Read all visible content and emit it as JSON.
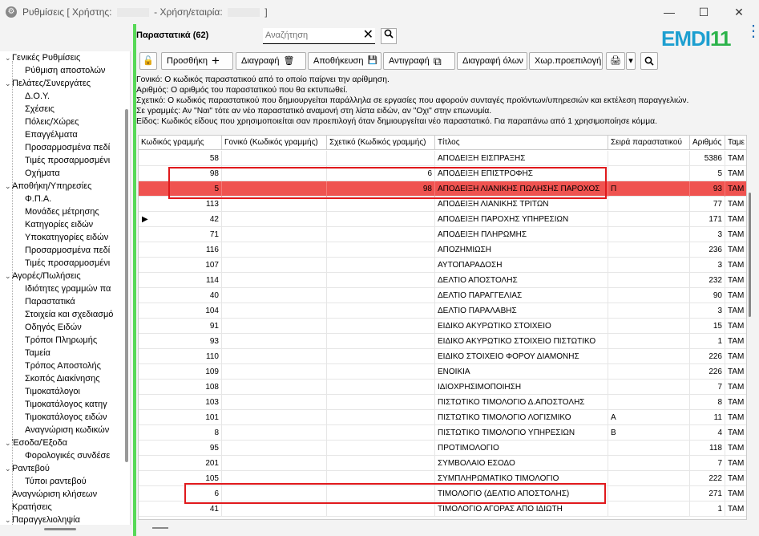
{
  "window": {
    "title": "Ρυθμίσεις",
    "user_label": "[ Χρήστης: ",
    "company_label": " - Χρήση/εταιρία: ",
    "close_bracket": " ]",
    "minimize": "—",
    "maximize": "☐",
    "close": "✕"
  },
  "sidebar": {
    "items": [
      {
        "label": "Γενικές Ρυθμίσεις",
        "level": 0,
        "expander": "⌄"
      },
      {
        "label": "Ρύθμιση αποστολών",
        "level": 1,
        "expander": ""
      },
      {
        "label": "Πελάτες/Συνεργάτες",
        "level": 0,
        "expander": "⌄"
      },
      {
        "label": "Δ.Ο.Υ.",
        "level": 1,
        "expander": ""
      },
      {
        "label": "Σχέσεις",
        "level": 1,
        "expander": ""
      },
      {
        "label": "Πόλεις/Χώρες",
        "level": 1,
        "expander": ""
      },
      {
        "label": "Επαγγέλματα",
        "level": 1,
        "expander": ""
      },
      {
        "label": "Προσαρμοσμένα πεδί",
        "level": 1,
        "expander": ""
      },
      {
        "label": "Τιμές προσαρμοσμένι",
        "level": 1,
        "expander": ""
      },
      {
        "label": "Οχήματα",
        "level": 1,
        "expander": ""
      },
      {
        "label": "Αποθήκη/Υπηρεσίες",
        "level": 0,
        "expander": "⌄"
      },
      {
        "label": "Φ.Π.Α.",
        "level": 1,
        "expander": ""
      },
      {
        "label": "Μονάδες μέτρησης",
        "level": 1,
        "expander": ""
      },
      {
        "label": "Κατηγορίες ειδών",
        "level": 1,
        "expander": ""
      },
      {
        "label": "Υποκατηγορίες ειδών",
        "level": 1,
        "expander": ""
      },
      {
        "label": "Προσαρμοσμένα πεδί",
        "level": 1,
        "expander": ""
      },
      {
        "label": "Τιμές προσαρμοσμένι",
        "level": 1,
        "expander": ""
      },
      {
        "label": "Αγορές/Πωλήσεις",
        "level": 0,
        "expander": "⌄"
      },
      {
        "label": "Ιδιότητες γραμμών πα",
        "level": 1,
        "expander": ""
      },
      {
        "label": "Παραστατικά",
        "level": 1,
        "expander": ""
      },
      {
        "label": "Στοιχεία και σχεδιασμό",
        "level": 1,
        "expander": ""
      },
      {
        "label": "Οδηγός Ειδών",
        "level": 1,
        "expander": ""
      },
      {
        "label": "Τρόποι Πληρωμής",
        "level": 1,
        "expander": ""
      },
      {
        "label": "Ταμεία",
        "level": 1,
        "expander": ""
      },
      {
        "label": "Τρόπος Αποστολής",
        "level": 1,
        "expander": ""
      },
      {
        "label": "Σκοπός Διακίνησης",
        "level": 1,
        "expander": ""
      },
      {
        "label": "Τιμοκατάλογοι",
        "level": 1,
        "expander": ""
      },
      {
        "label": "Τιμοκατάλογος κατηγ",
        "level": 1,
        "expander": ""
      },
      {
        "label": "Τιμοκατάλογος ειδών",
        "level": 1,
        "expander": ""
      },
      {
        "label": "Αναγνώριση κωδικών",
        "level": 1,
        "expander": ""
      },
      {
        "label": "Έσοδα/Έξοδα",
        "level": 0,
        "expander": "⌄"
      },
      {
        "label": "Φορολογικές συνδέσε",
        "level": 1,
        "expander": ""
      },
      {
        "label": "Ραντεβού",
        "level": 0,
        "expander": "⌄"
      },
      {
        "label": "Τύποι ραντεβού",
        "level": 1,
        "expander": ""
      },
      {
        "label": "Αναγνώριση κλήσεων",
        "level": 0,
        "expander": ""
      },
      {
        "label": "Κρατήσεις",
        "level": 0,
        "expander": ""
      },
      {
        "label": "Παραγγελιοληψία",
        "level": 0,
        "expander": "⌄"
      }
    ]
  },
  "header": {
    "title": "Παραστατικά (62)",
    "search_placeholder": "Αναζήτηση",
    "clear": "✕",
    "search_icon": "search-icon",
    "logo_main": "EMDI",
    "logo_accent": "11",
    "menu": "⋮"
  },
  "toolbar": {
    "lock": "🔓",
    "add": "Προσθήκη",
    "add_icon": "+",
    "delete": "Διαγραφή",
    "delete_icon": "🗑",
    "save": "Αποθήκευση",
    "save_icon": "💾",
    "copy": "Αντιγραφή",
    "copy_icon": "⧉",
    "delete_all": "Διαγραφή όλων",
    "default": "Χωρ.προεπιλογή",
    "print_icon": "🖨",
    "dropdown": "▾",
    "search_icon": "search-icon"
  },
  "info": [
    "Γονικό: Ο κωδικός παραστατικού από το οποίο παίρνει την αρίθμηση.",
    "Αριθμός: Ο αριθμός του παραστατικού που θα εκτυπωθεί.",
    "Σχετικό: Ο κωδικός παραστατικού που δημιουργείται παράλληλα σε εργασίες που αφορούν συνταγές προϊόντων/υπηρεσιών και εκτέλεση παραγγελιών.",
    "Σε γραμμές: Αν \"Ναι\" τότε αν νέο παραστατικό αναμονή στη λίστα ειδών, αν \"Οχι\" στην επωνυμία.",
    "Είδος: Κωδικός είδους που χρησιμοποιείται σαν προεπιλογή όταν δημιουργείται νέο παραστατικό. Για παραπάνω από 1 χρησιμοποίησε κόμμα."
  ],
  "grid": {
    "columns": [
      "Κωδικός γραμμής",
      "Γονικό (Κωδικός γραμμής)",
      "Σχετικό (Κωδικός γραμμής)",
      "Τίτλος",
      "Σειρά παραστατικού",
      "Αριθμός",
      "Ταμε"
    ],
    "rows": [
      {
        "code": "58",
        "parent": "",
        "related": "",
        "title": "ΑΠΟΔΕΙΞΗ ΕΙΣΠΡΑΞΗΣ",
        "series": "",
        "number": "5386",
        "cash": "ΤΑΜ"
      },
      {
        "code": "98",
        "parent": "",
        "related": "6",
        "title": "ΑΠΟΔΕΙΞΗ ΕΠΙΣΤΡΟΦΗΣ",
        "series": "",
        "number": "5",
        "cash": "ΤΑΜ"
      },
      {
        "code": "5",
        "parent": "",
        "related": "98",
        "title": "ΑΠΟΔΕΙΞΗ ΛΙΑΝΙΚΗΣ ΠΩΛΗΣΗΣ ΠΑΡΟΧΟΣ",
        "series": "Π",
        "number": "93",
        "cash": "ΤΑΜ"
      },
      {
        "code": "113",
        "parent": "",
        "related": "",
        "title": "ΑΠΟΔΕΙΞΗ ΛΙΑΝΙΚΗΣ ΤΡΙΤΩΝ",
        "series": "",
        "number": "77",
        "cash": "ΤΑΜ"
      },
      {
        "code": "42",
        "parent": "",
        "related": "",
        "title": "ΑΠΟΔΕΙΞΗ ΠΑΡΟΧΗΣ ΥΠΗΡΕΣΙΩΝ",
        "series": "",
        "number": "171",
        "cash": "ΤΑΜ"
      },
      {
        "code": "71",
        "parent": "",
        "related": "",
        "title": "ΑΠΟΔΕΙΞΗ ΠΛΗΡΩΜΗΣ",
        "series": "",
        "number": "3",
        "cash": "ΤΑΜ"
      },
      {
        "code": "116",
        "parent": "",
        "related": "",
        "title": "ΑΠΟΖΗΜΙΩΣΗ",
        "series": "",
        "number": "236",
        "cash": "ΤΑΜ"
      },
      {
        "code": "107",
        "parent": "",
        "related": "",
        "title": "ΑΥΤΟΠΑΡΑΔΟΣΗ",
        "series": "",
        "number": "3",
        "cash": "ΤΑΜ"
      },
      {
        "code": "114",
        "parent": "",
        "related": "",
        "title": "ΔΕΛΤΙΟ ΑΠΟΣΤΟΛΗΣ",
        "series": "",
        "number": "232",
        "cash": "ΤΑΜ"
      },
      {
        "code": "40",
        "parent": "",
        "related": "",
        "title": "ΔΕΛΤΙΟ ΠΑΡΑΓΓΕΛΙΑΣ",
        "series": "",
        "number": "90",
        "cash": "ΤΑΜ"
      },
      {
        "code": "104",
        "parent": "",
        "related": "",
        "title": "ΔΕΛΤΙΟ ΠΑΡΑΛΑΒΗΣ",
        "series": "",
        "number": "3",
        "cash": "ΤΑΜ"
      },
      {
        "code": "91",
        "parent": "",
        "related": "",
        "title": "ΕΙΔΙΚΟ ΑΚΥΡΩΤΙΚΟ ΣΤΟΙΧΕΙΟ",
        "series": "",
        "number": "15",
        "cash": "ΤΑΜ"
      },
      {
        "code": "93",
        "parent": "",
        "related": "",
        "title": "ΕΙΔΙΚΟ ΑΚΥΡΩΤΙΚΟ ΣΤΟΙΧΕΙΟ ΠΙΣΤΩΤΙΚΟ",
        "series": "",
        "number": "1",
        "cash": "ΤΑΜ"
      },
      {
        "code": "110",
        "parent": "",
        "related": "",
        "title": "ΕΙΔΙΚΟ ΣΤΟΙΧΕΙΟ ΦΟΡΟΥ ΔΙΑΜΟΝΗΣ",
        "series": "",
        "number": "226",
        "cash": "ΤΑΜ"
      },
      {
        "code": "109",
        "parent": "",
        "related": "",
        "title": "ΕΝΟΙΚΙΑ",
        "series": "",
        "number": "226",
        "cash": "ΤΑΜ"
      },
      {
        "code": "108",
        "parent": "",
        "related": "",
        "title": "ΙΔΙΟΧΡΗΣΙΜΟΠΟΙΗΣΗ",
        "series": "",
        "number": "7",
        "cash": "ΤΑΜ"
      },
      {
        "code": "103",
        "parent": "",
        "related": "",
        "title": "ΠΙΣΤΩΤΙΚΟ ΤΙΜΟΛΟΓΙΟ Δ.ΑΠΟΣΤΟΛΗΣ",
        "series": "",
        "number": "8",
        "cash": "ΤΑΜ"
      },
      {
        "code": "101",
        "parent": "",
        "related": "",
        "title": "ΠΙΣΤΩΤΙΚΟ ΤΙΜΟΛΟΓΙΟ ΛΟΓΙΣΜΙΚΟ",
        "series": "Α",
        "number": "11",
        "cash": "ΤΑΜ"
      },
      {
        "code": "8",
        "parent": "",
        "related": "",
        "title": "ΠΙΣΤΩΤΙΚΟ ΤΙΜΟΛΟΓΙΟ ΥΠΗΡΕΣΙΩΝ",
        "series": "Β",
        "number": "4",
        "cash": "ΤΑΜ"
      },
      {
        "code": "95",
        "parent": "",
        "related": "",
        "title": "ΠΡΟΤΙΜΟΛΟΓΙΟ",
        "series": "",
        "number": "118",
        "cash": "ΤΑΜ"
      },
      {
        "code": "201",
        "parent": "",
        "related": "",
        "title": "ΣΥΜΒΟΛΑΙΟ ΕΣΟΔΟ",
        "series": "",
        "number": "7",
        "cash": "ΤΑΜ"
      },
      {
        "code": "105",
        "parent": "",
        "related": "",
        "title": "ΣΥΜΠΛΗΡΩΜΑΤΙΚΟ ΤΙΜΟΛΟΓΙΟ",
        "series": "",
        "number": "222",
        "cash": "ΤΑΜ"
      },
      {
        "code": "6",
        "parent": "",
        "related": "",
        "title": "ΤΙΜΟΛΟΓΙΟ (ΔΕΛΤΙΟ ΑΠΟΣΤΟΛΗΣ)",
        "series": "",
        "number": "271",
        "cash": "ΤΑΜ"
      },
      {
        "code": "41",
        "parent": "",
        "related": "",
        "title": "ΤΙΜΟΛΟΓΙΟ ΑΓΟΡΑΣ ΑΠΟ ΙΔΙΩΤΗ",
        "series": "",
        "number": "1",
        "cash": "ΤΑΜ"
      }
    ],
    "selected_index": 2,
    "current_marker_index": 4,
    "marker": "▶"
  },
  "colors": {
    "selected_row": "#ef5350",
    "highlight_box": "#e0191c",
    "logo_blue": "#1d9fd0",
    "logo_green": "#2bb34a",
    "accent_line": "#57d957"
  }
}
